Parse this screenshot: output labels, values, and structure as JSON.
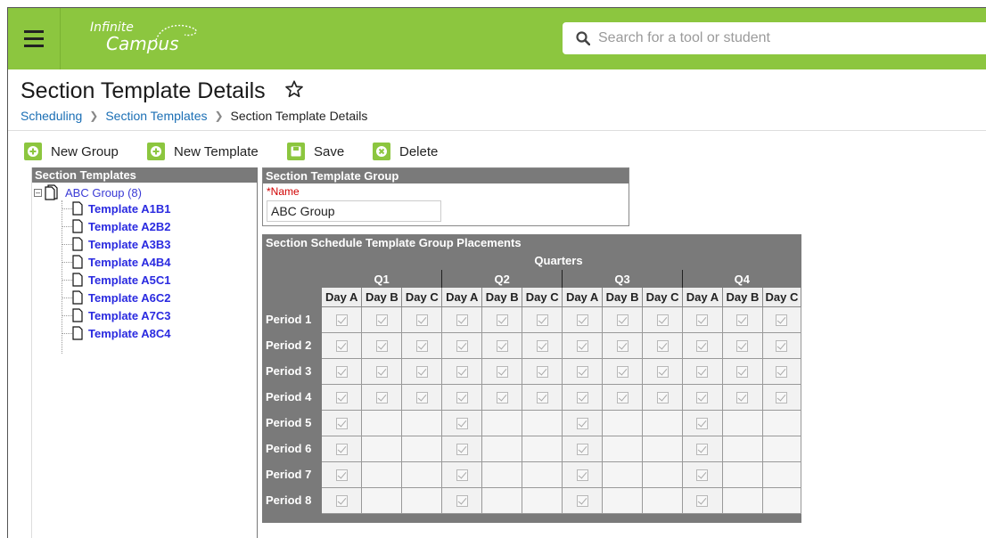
{
  "header": {
    "logo_line1": "Infinite",
    "logo_line2": "Campus",
    "search_placeholder": "Search for a tool or student",
    "brand_color": "#8cc63f"
  },
  "page": {
    "title": "Section Template Details",
    "breadcrumb": [
      "Scheduling",
      "Section Templates",
      "Section Template Details"
    ]
  },
  "toolbar": {
    "new_group": "New Group",
    "new_template": "New Template",
    "save": "Save",
    "delete": "Delete"
  },
  "tree": {
    "heading": "Section Templates",
    "root_label": "ABC Group (8)",
    "items": [
      "Template A1B1",
      "Template A2B2",
      "Template A3B3",
      "Template A4B4",
      "Template A5C1",
      "Template A6C2",
      "Template A7C3",
      "Template A8C4"
    ]
  },
  "group": {
    "heading": "Section Template Group",
    "name_label": "*Name",
    "name_value": "ABC Group"
  },
  "placements": {
    "heading": "Section Schedule Template Group Placements",
    "quarters_label": "Quarters",
    "quarters": [
      "Q1",
      "Q2",
      "Q3",
      "Q4"
    ],
    "days": [
      "Day A",
      "Day B",
      "Day C"
    ],
    "periods": [
      "Period 1",
      "Period 2",
      "Period 3",
      "Period 4",
      "Period 5",
      "Period 6",
      "Period 7",
      "Period 8"
    ],
    "checked_days_by_period": [
      [
        "Day A",
        "Day B",
        "Day C"
      ],
      [
        "Day A",
        "Day B",
        "Day C"
      ],
      [
        "Day A",
        "Day B",
        "Day C"
      ],
      [
        "Day A",
        "Day B",
        "Day C"
      ],
      [
        "Day A"
      ],
      [
        "Day A"
      ],
      [
        "Day A"
      ],
      [
        "Day A"
      ]
    ]
  }
}
